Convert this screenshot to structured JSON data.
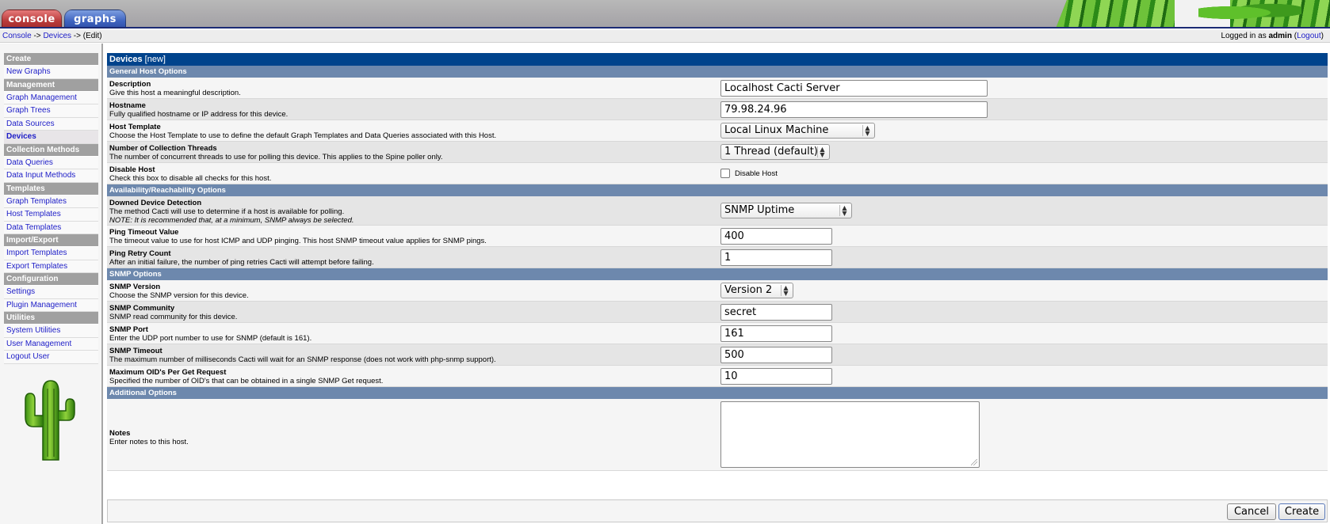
{
  "header": {
    "tabs": [
      {
        "label": "console"
      },
      {
        "label": "graphs"
      }
    ]
  },
  "breadcrumb": {
    "console": "Console",
    "sep1": " -> ",
    "devices": "Devices",
    "sep2": " -> ",
    "current": "(Edit)",
    "logged_in_prefix": "Logged in as ",
    "user": "admin",
    "logout": "Logout"
  },
  "sidebar": {
    "groups": [
      {
        "head": "Create",
        "items": [
          "New Graphs"
        ]
      },
      {
        "head": "Management",
        "items": [
          "Graph Management",
          "Graph Trees",
          "Data Sources",
          "Devices"
        ]
      },
      {
        "head": "Collection Methods",
        "items": [
          "Data Queries",
          "Data Input Methods"
        ]
      },
      {
        "head": "Templates",
        "items": [
          "Graph Templates",
          "Host Templates",
          "Data Templates"
        ]
      },
      {
        "head": "Import/Export",
        "items": [
          "Import Templates",
          "Export Templates"
        ]
      },
      {
        "head": "Configuration",
        "items": [
          "Settings",
          "Plugin Management"
        ]
      },
      {
        "head": "Utilities",
        "items": [
          "System Utilities",
          "User Management",
          "Logout User"
        ]
      }
    ],
    "active_item": "Devices"
  },
  "form": {
    "title": "Devices",
    "title_suffix": "[new]",
    "sections": {
      "general": "General Host Options",
      "availability": "Availability/Reachability Options",
      "snmp": "SNMP Options",
      "additional": "Additional Options"
    },
    "description": {
      "label": "Description",
      "help": "Give this host a meaningful description.",
      "value": "Localhost Cacti Server"
    },
    "hostname": {
      "label": "Hostname",
      "help": "Fully qualified hostname or IP address for this device.",
      "value": "79.98.24.96"
    },
    "host_template": {
      "label": "Host Template",
      "help": "Choose the Host Template to use to define the default Graph Templates and Data Queries associated with this Host.",
      "value": "Local Linux Machine"
    },
    "threads": {
      "label": "Number of Collection Threads",
      "help": "The number of concurrent threads to use for polling this device. This applies to the Spine poller only.",
      "value": "1 Thread (default)"
    },
    "disable_host": {
      "label": "Disable Host",
      "help": "Check this box to disable all checks for this host.",
      "checkbox_label": "Disable Host"
    },
    "downed_detection": {
      "label": "Downed Device Detection",
      "help": "The method Cacti will use to determine if a host is available for polling.",
      "note": "NOTE: It is recommended that, at a minimum, SNMP always be selected.",
      "value": "SNMP Uptime"
    },
    "ping_timeout": {
      "label": "Ping Timeout Value",
      "help": "The timeout value to use for host ICMP and UDP pinging. This host SNMP timeout value applies for SNMP pings.",
      "value": "400"
    },
    "ping_retry": {
      "label": "Ping Retry Count",
      "help": "After an initial failure, the number of ping retries Cacti will attempt before failing.",
      "value": "1"
    },
    "snmp_version": {
      "label": "SNMP Version",
      "help": "Choose the SNMP version for this device.",
      "value": "Version 2"
    },
    "snmp_community": {
      "label": "SNMP Community",
      "help": "SNMP read community for this device.",
      "value": "secret"
    },
    "snmp_port": {
      "label": "SNMP Port",
      "help": "Enter the UDP port number to use for SNMP (default is 161).",
      "value": "161"
    },
    "snmp_timeout": {
      "label": "SNMP Timeout",
      "help": "The maximum number of milliseconds Cacti will wait for an SNMP response (does not work with php-snmp support).",
      "value": "500"
    },
    "max_oids": {
      "label": "Maximum OID's Per Get Request",
      "help": "Specified the number of OID's that can be obtained in a single SNMP Get request.",
      "value": "10"
    },
    "notes": {
      "label": "Notes",
      "help": "Enter notes to this host.",
      "value": ""
    }
  },
  "buttons": {
    "cancel": "Cancel",
    "create": "Create"
  },
  "colors": {
    "title_bar": "#00438c",
    "section_bar": "#6d88ad",
    "link": "#2020c8"
  }
}
